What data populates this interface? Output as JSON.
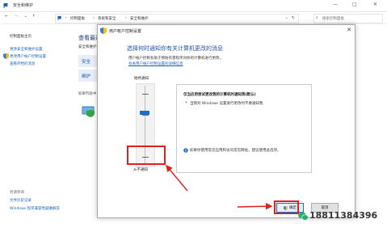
{
  "window": {
    "title": "安全和维护",
    "controls": [
      "—",
      "□",
      "✕"
    ]
  },
  "address": {
    "crumbs": [
      "控制面板",
      "系统和安全",
      "安全和维护"
    ],
    "search_placeholder": "搜索控制面板"
  },
  "left_panel": {
    "home": "控制面板主页",
    "links": [
      "更改安全和维护设置",
      "更改用户帐户控制设置",
      "查看存档的消息"
    ],
    "see_also_title": "另请参阅",
    "see_also": [
      "文件历史记录",
      "Windows 程序兼容性疑难解答"
    ]
  },
  "main_behind": {
    "heading": "查看最近",
    "sub": "安全和维护",
    "sec1": "安全",
    "sec2": "维护",
    "note": "如果列表中"
  },
  "dialog": {
    "title": "用户帐户控制设置",
    "heading": "选择何时通知你有关计算机更改的消息",
    "desc": "用户帐户控制有助于预防有害程序对你的计算机进行更改。",
    "link": "有关用户帐户控制设置的详细信息",
    "slider_top": "始终通知",
    "slider_bottom": "从不通知",
    "slider_level": 3,
    "slider_levels": 4,
    "info_title": "仅当应用尝试更改我的计算机时通知我(默认)",
    "info_bullet": "当我对 Windows 设置进行更改时不要通知我",
    "info_note": "如果你使用常见应用和访问常见网站，建议使用此选项。",
    "ok": "确定",
    "cancel": "取消"
  },
  "watermark": {
    "text": "18811384396"
  },
  "colors": {
    "accent": "#1c6ec7",
    "highlight_box": "#e0201a",
    "heading": "#1f55a8"
  }
}
